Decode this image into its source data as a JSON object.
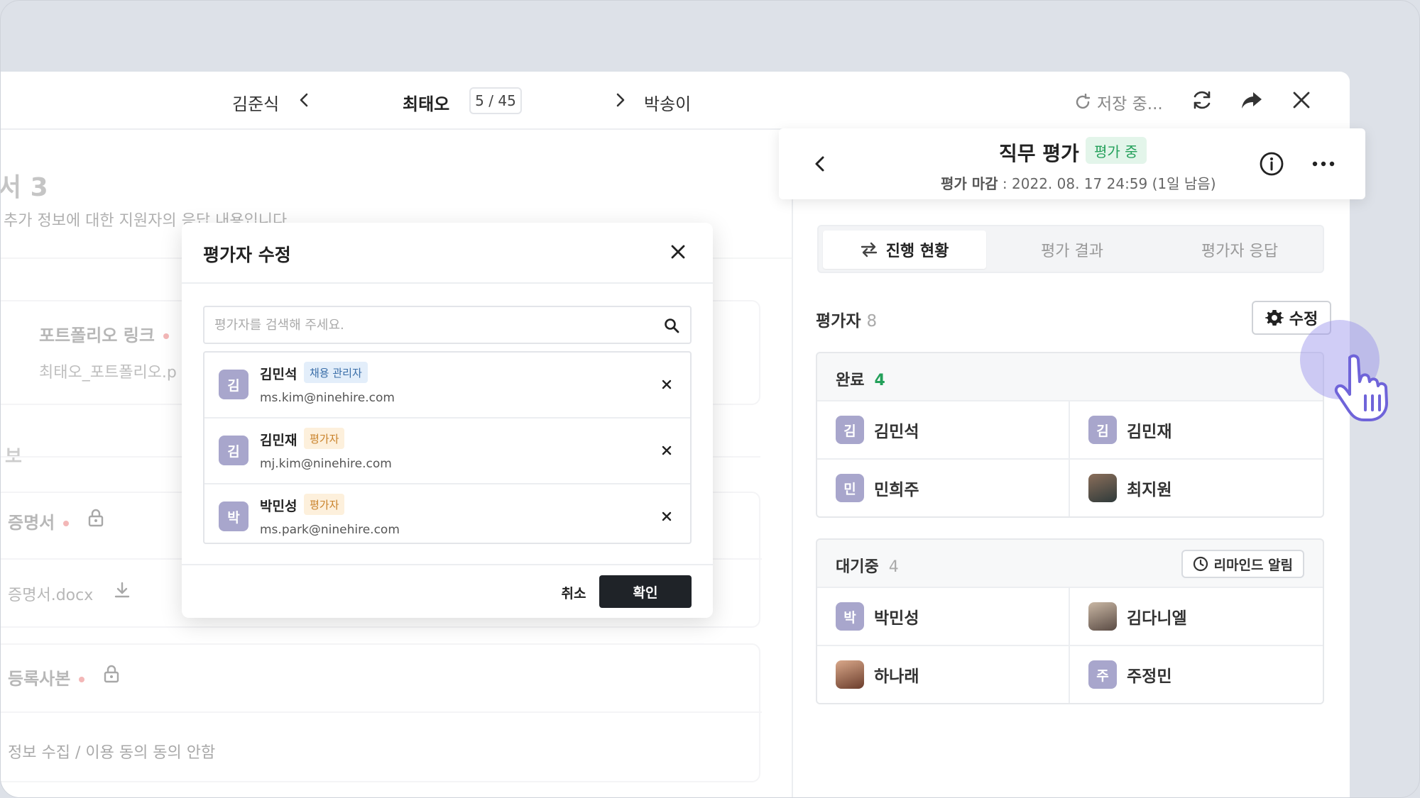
{
  "topbar": {
    "prev_name": "김준식",
    "current_name": "최태오",
    "counter": "5 / 45",
    "next_name": "박송이",
    "saving": "저장 중..."
  },
  "background": {
    "section_title": "서 3",
    "section_desc": "추가 정보에 대한 지원자의 응답 내용입니다.",
    "portfolio_label": "포트폴리오 링크",
    "portfolio_value": "최태오_포트폴리오.p",
    "info_heading": "보",
    "cert_label": "증명서",
    "cert_file": "증명서.docx",
    "reg_label": "등록사본",
    "privacy": "정보 수집 / 이용 동의 동의 안함"
  },
  "panel": {
    "title": "직무 평가",
    "status": "평가 중",
    "deadline_label": "평가 마감",
    "deadline_value": " : 2022. 08. 17 24:59 (1일 남음)",
    "tabs": [
      "진행 현황",
      "평가 결과",
      "평가자 응답"
    ],
    "evaluators_label": "평가자",
    "evaluators_count": "8",
    "edit_label": "수정",
    "done": {
      "label": "완료",
      "count": "4",
      "people": [
        {
          "initial": "김",
          "name": "김민석"
        },
        {
          "initial": "김",
          "name": "김민재"
        },
        {
          "initial": "민",
          "name": "민희주"
        },
        {
          "initial": "",
          "name": "최지원"
        }
      ]
    },
    "waiting": {
      "label": "대기중",
      "count": "4",
      "remind_label": "리마인드 알림",
      "people": [
        {
          "initial": "박",
          "name": "박민성"
        },
        {
          "initial": "",
          "name": "김다니엘"
        },
        {
          "initial": "",
          "name": "하나래"
        },
        {
          "initial": "주",
          "name": "주정민"
        }
      ]
    }
  },
  "modal": {
    "title": "평가자 수정",
    "search_placeholder": "평가자를 검색해 주세요.",
    "rows": [
      {
        "initial": "김",
        "name": "김민석",
        "role": "채용 관리자",
        "email": "ms.kim@ninehire.com"
      },
      {
        "initial": "김",
        "name": "김민재",
        "role": "평가자",
        "email": "mj.kim@ninehire.com"
      },
      {
        "initial": "박",
        "name": "박민성",
        "role": "평가자",
        "email": "ms.park@ninehire.com"
      }
    ],
    "cancel_label": "취소",
    "confirm_label": "확인"
  },
  "colors": {
    "accent_green": "#23a05a",
    "avatar_purple": "#a8a6cc",
    "confirm_dark": "#1f2328"
  }
}
